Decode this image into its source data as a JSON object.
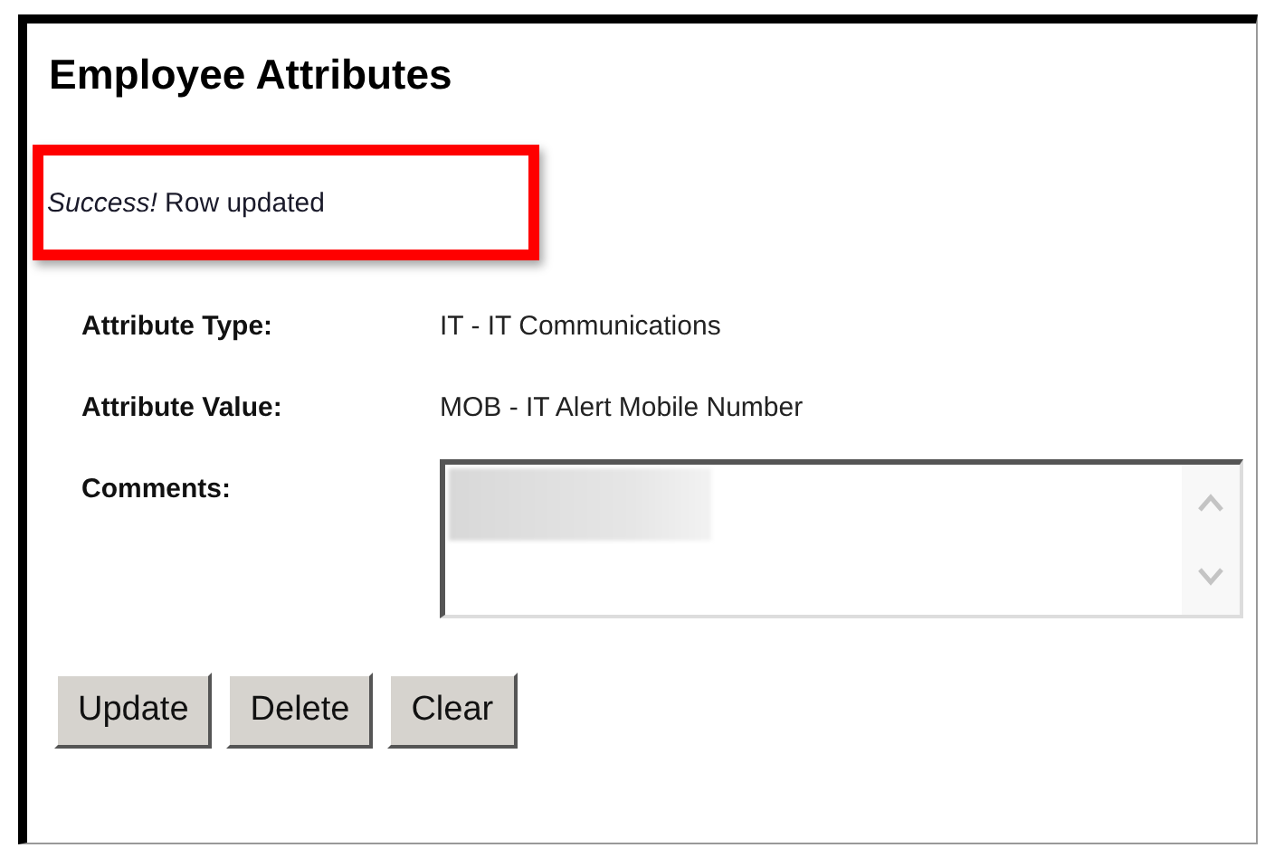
{
  "title": "Employee Attributes",
  "message": {
    "text": "*Success!* Row updated",
    "highlighted": true
  },
  "fields": [
    {
      "kind": "text",
      "label": "Attribute Type:",
      "value": "IT - IT Communications"
    },
    {
      "kind": "text",
      "label": "Attribute Value:",
      "value": "MOB - IT Alert Mobile Number"
    },
    {
      "kind": "textarea",
      "label": "Comments:",
      "redacted": true
    }
  ],
  "buttons": [
    "Update",
    "Delete",
    "Clear"
  ]
}
